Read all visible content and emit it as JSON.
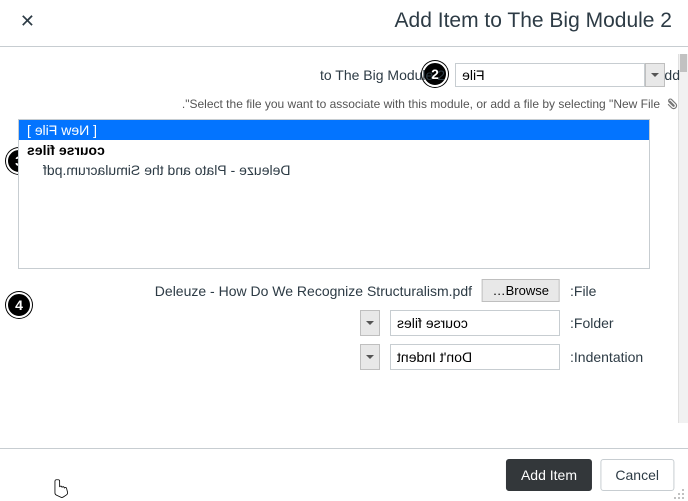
{
  "header": {
    "title": "Add Item to The Big Module 2",
    "close_label": "✕"
  },
  "step_badges": {
    "s2": "2",
    "s3": "3",
    "s4": "4"
  },
  "add_row": {
    "prefix": "Add",
    "type_value": "File",
    "suffix": "to The Big Module 2"
  },
  "hint": "Select the file you want to associate with this module, or add a file by selecting \"New File\".",
  "file_list": {
    "options": [
      {
        "label": "[ New File ]",
        "kind": "action",
        "selected": true
      },
      {
        "label": "course files",
        "kind": "group",
        "selected": false
      },
      {
        "label": "Deleuze - Plato and the Simulacrum.pdf",
        "kind": "item",
        "selected": false
      }
    ]
  },
  "file_row": {
    "label": "File:",
    "browse": "Browse…",
    "chosen": "Deleuze - How Do We Recognize Structuralism.pdf"
  },
  "folder_row": {
    "label": "Folder:",
    "value": "course files"
  },
  "indent_row": {
    "label": "Indentation:",
    "value": "Don't Indent"
  },
  "footer": {
    "cancel": "Cancel",
    "add": "Add Item"
  }
}
